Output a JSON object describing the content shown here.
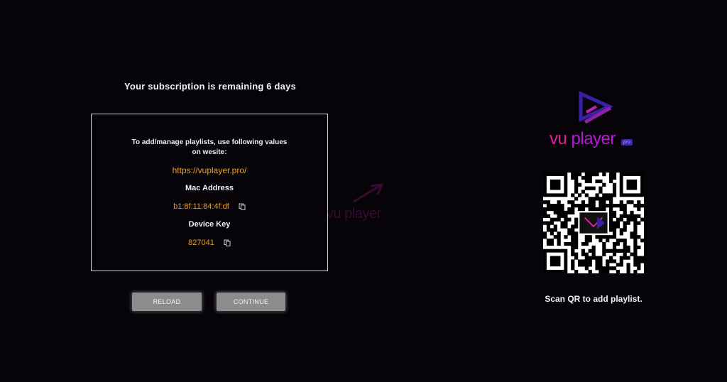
{
  "subscription": {
    "message": "Your subscription is remaining 6 days"
  },
  "info": {
    "instructions_line1": "To add/manage playlists, use following values",
    "instructions_line2": "on wesite:",
    "website": "https://vuplayer.pro/",
    "mac_heading": "Mac Address",
    "mac_value": "b1:8f:11:84:4f:df",
    "key_heading": "Device Key",
    "key_value": "827041"
  },
  "buttons": {
    "reload": "RELOAD",
    "continue": "CONTINUE"
  },
  "brand": {
    "vu": "vu",
    "player": "player",
    "badge": "pro",
    "watermark": "vu player"
  },
  "qr": {
    "caption": "Scan QR to add playlist."
  },
  "colors": {
    "accent_orange": "#e8a22c",
    "brand_pink": "#e0219e",
    "brand_purple": "#b61bd6",
    "button_gray": "#8c8c8c"
  },
  "icons": {
    "copy": "copy-icon",
    "logo": "play-triangle-icon",
    "qr": "qr-code-icon"
  }
}
